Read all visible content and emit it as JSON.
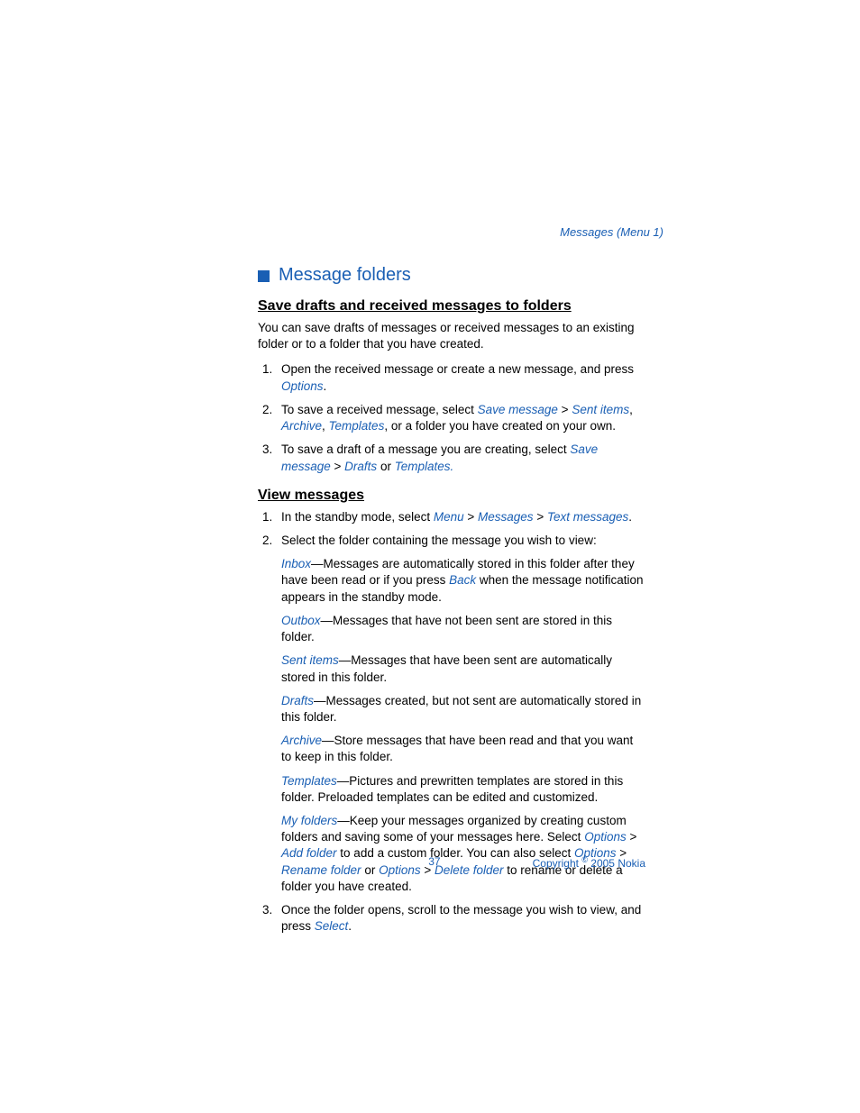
{
  "header": {
    "tag": "Messages (Menu 1)"
  },
  "sectionTitle": "Message folders",
  "sub1": {
    "title": "Save drafts and received messages to folders",
    "intro": "You can save drafts of messages or received messages to an existing folder or to a folder that you have created.",
    "step1_a": "Open the received message or create a new message, and press ",
    "step1_link": "Options",
    "step1_b": ".",
    "step2_a": "To save a received message, select ",
    "step2_l1": "Save message",
    "step2_gt1": " > ",
    "step2_l2": "Sent items",
    "step2_sep1": ", ",
    "step2_l3": "Archive",
    "step2_sep2": ", ",
    "step2_l4": "Templates",
    "step2_b": ", or a folder you have created on your own.",
    "step3_a": "To save a draft of a message you are creating, select ",
    "step3_l1": "Save message",
    "step3_gt1": " > ",
    "step3_l2": "Drafts",
    "step3_b": " or ",
    "step3_l3": "Templates."
  },
  "sub2": {
    "title": "View messages",
    "step1_a": "In the standby mode, select ",
    "step1_l1": "Menu",
    "step1_gt1": " > ",
    "step1_l2": "Messages",
    "step1_gt2": " > ",
    "step1_l3": "Text messages",
    "step1_b": ".",
    "step2": "Select the folder containing the message you wish to view:",
    "inbox_l": "Inbox",
    "inbox_a": "—Messages are automatically stored in this folder after they have been read or if you press ",
    "inbox_l2": "Back",
    "inbox_b": " when the message notification appears in the standby mode.",
    "outbox_l": "Outbox",
    "outbox_a": "—Messages that have not been sent are stored in this folder.",
    "sent_l": "Sent items",
    "sent_a": "—Messages that have been sent are automatically stored in this folder.",
    "drafts_l": "Drafts",
    "drafts_a": "—Messages created, but not sent are automatically stored in this folder.",
    "archive_l": "Archive",
    "archive_a": "—Store messages that have been read and that you want to keep in this folder.",
    "templates_l": "Templates",
    "templates_a": "—Pictures and prewritten templates are stored in this folder. Preloaded templates can be edited and customized.",
    "myf_l": "My folders",
    "myf_a": "—Keep your messages organized by creating custom folders and saving some of your messages here. Select ",
    "myf_l2": "Options",
    "myf_gt1": " > ",
    "myf_l3": "Add folder",
    "myf_b": " to add a custom folder. You can also select ",
    "myf_l4": "Options",
    "myf_gt2": " > ",
    "myf_l5": "Rename folder",
    "myf_c": " or ",
    "myf_l6": "Options",
    "myf_gt3": " > ",
    "myf_l7": "Delete folder",
    "myf_d": " to rename or delete a folder you have created.",
    "step3_a": "Once the folder opens, scroll to the message you wish to view, and press ",
    "step3_l1": "Select",
    "step3_b": "."
  },
  "footer": {
    "pageNum": "37",
    "copyright_a": "Copyright ",
    "copyright_sup": "©",
    "copyright_b": " 2005 Nokia"
  }
}
